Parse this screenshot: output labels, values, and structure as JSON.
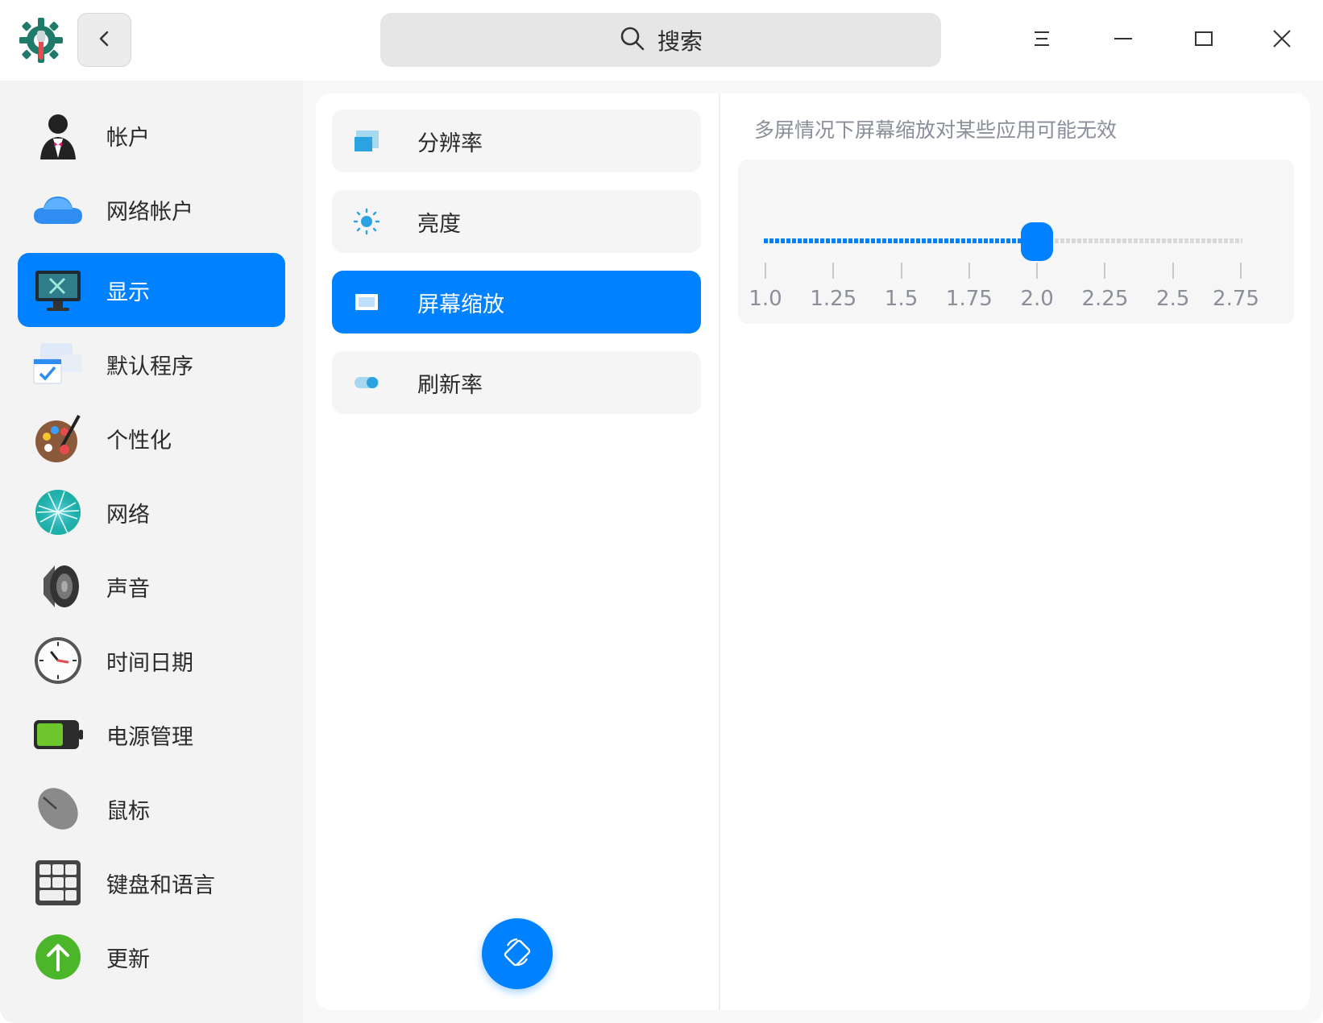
{
  "titlebar": {
    "search_label": "搜索",
    "icons": [
      "app-logo-icon",
      "back-icon",
      "search-icon",
      "menu-icon",
      "minimize-icon",
      "maximize-icon",
      "close-icon"
    ]
  },
  "sidebar": {
    "items": [
      {
        "label": "帐户",
        "icon": "account-icon"
      },
      {
        "label": "网络帐户",
        "icon": "cloud-icon"
      },
      {
        "label": "显示",
        "icon": "display-icon",
        "active": true
      },
      {
        "label": "默认程序",
        "icon": "default-apps-icon"
      },
      {
        "label": "个性化",
        "icon": "palette-icon"
      },
      {
        "label": "网络",
        "icon": "network-icon"
      },
      {
        "label": "声音",
        "icon": "speaker-icon"
      },
      {
        "label": "时间日期",
        "icon": "clock-icon"
      },
      {
        "label": "电源管理",
        "icon": "battery-icon"
      },
      {
        "label": "鼠标",
        "icon": "mouse-icon"
      },
      {
        "label": "键盘和语言",
        "icon": "keyboard-icon"
      },
      {
        "label": "更新",
        "icon": "update-icon"
      }
    ]
  },
  "display_menu": {
    "items": [
      {
        "label": "分辨率",
        "icon": "resolution-icon"
      },
      {
        "label": "亮度",
        "icon": "brightness-icon"
      },
      {
        "label": "屏幕缩放",
        "icon": "scale-icon",
        "active": true
      },
      {
        "label": "刷新率",
        "icon": "refresh-rate-icon"
      }
    ],
    "rotate_button_icon": "rotate-screen-icon"
  },
  "scaling": {
    "hint": "多屏情况下屏幕缩放对某些应用可能无效",
    "ticks": [
      "1.0",
      "1.25",
      "1.5",
      "1.75",
      "2.0",
      "2.25",
      "2.5",
      "2.75"
    ],
    "value": "2.0",
    "value_index": 4
  },
  "colors": {
    "accent": "#0081ff",
    "inactive_track": "#d9d9d9",
    "hint_text": "#8a8f99"
  }
}
